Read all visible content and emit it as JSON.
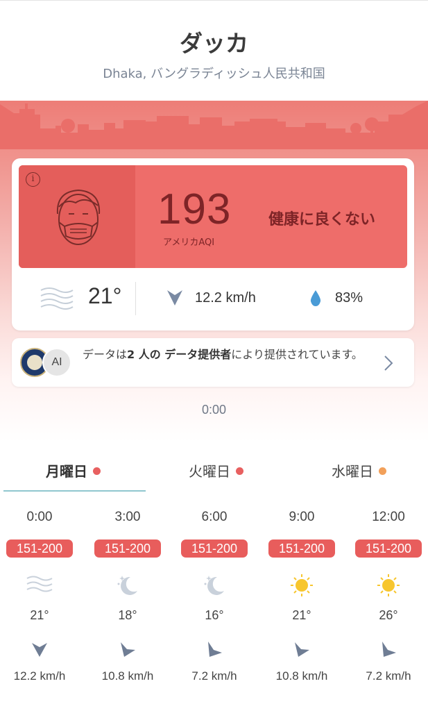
{
  "header": {
    "city": "ダッカ",
    "location": "Dhaka, バングラディッシュ人民共和国"
  },
  "aqi_card": {
    "info_icon": "info-icon",
    "value": "193",
    "unit": "アメリカAQI",
    "status": "健康に良くない",
    "panel_color": "#ee6d6a",
    "temperature": "21°",
    "wind_speed": "12.2 km/h",
    "humidity": "83%"
  },
  "provider": {
    "badge_label": "AI",
    "text_prefix": "データは",
    "text_count": "2 人の データ提供者",
    "text_suffix": "により提供されています。"
  },
  "timeline": {
    "current_time": "0:00"
  },
  "day_tabs": [
    {
      "label": "月曜日",
      "dot_color": "#e86060",
      "active": true
    },
    {
      "label": "火曜日",
      "dot_color": "#e86060",
      "active": false
    },
    {
      "label": "水曜日",
      "dot_color": "#f2a05a",
      "active": false
    }
  ],
  "hourly": [
    {
      "time": "0:00",
      "aqi_range": "151-200",
      "icon": "wind-icon",
      "temp": "21°",
      "wind": "12.2 km/h"
    },
    {
      "time": "3:00",
      "aqi_range": "151-200",
      "icon": "moon-icon",
      "temp": "18°",
      "wind": "10.8 km/h"
    },
    {
      "time": "6:00",
      "aqi_range": "151-200",
      "icon": "moon-icon",
      "temp": "16°",
      "wind": "7.2 km/h"
    },
    {
      "time": "9:00",
      "aqi_range": "151-200",
      "icon": "sun-icon",
      "temp": "21°",
      "wind": "10.8 km/h"
    },
    {
      "time": "12:00",
      "aqi_range": "151-200",
      "icon": "sun-icon",
      "temp": "26°",
      "wind": "7.2 km/h"
    }
  ],
  "colors": {
    "aqi_unhealthy": "#ee6d6a",
    "badge": "#e85d5c",
    "accent_underline": "#8fc7cf"
  }
}
